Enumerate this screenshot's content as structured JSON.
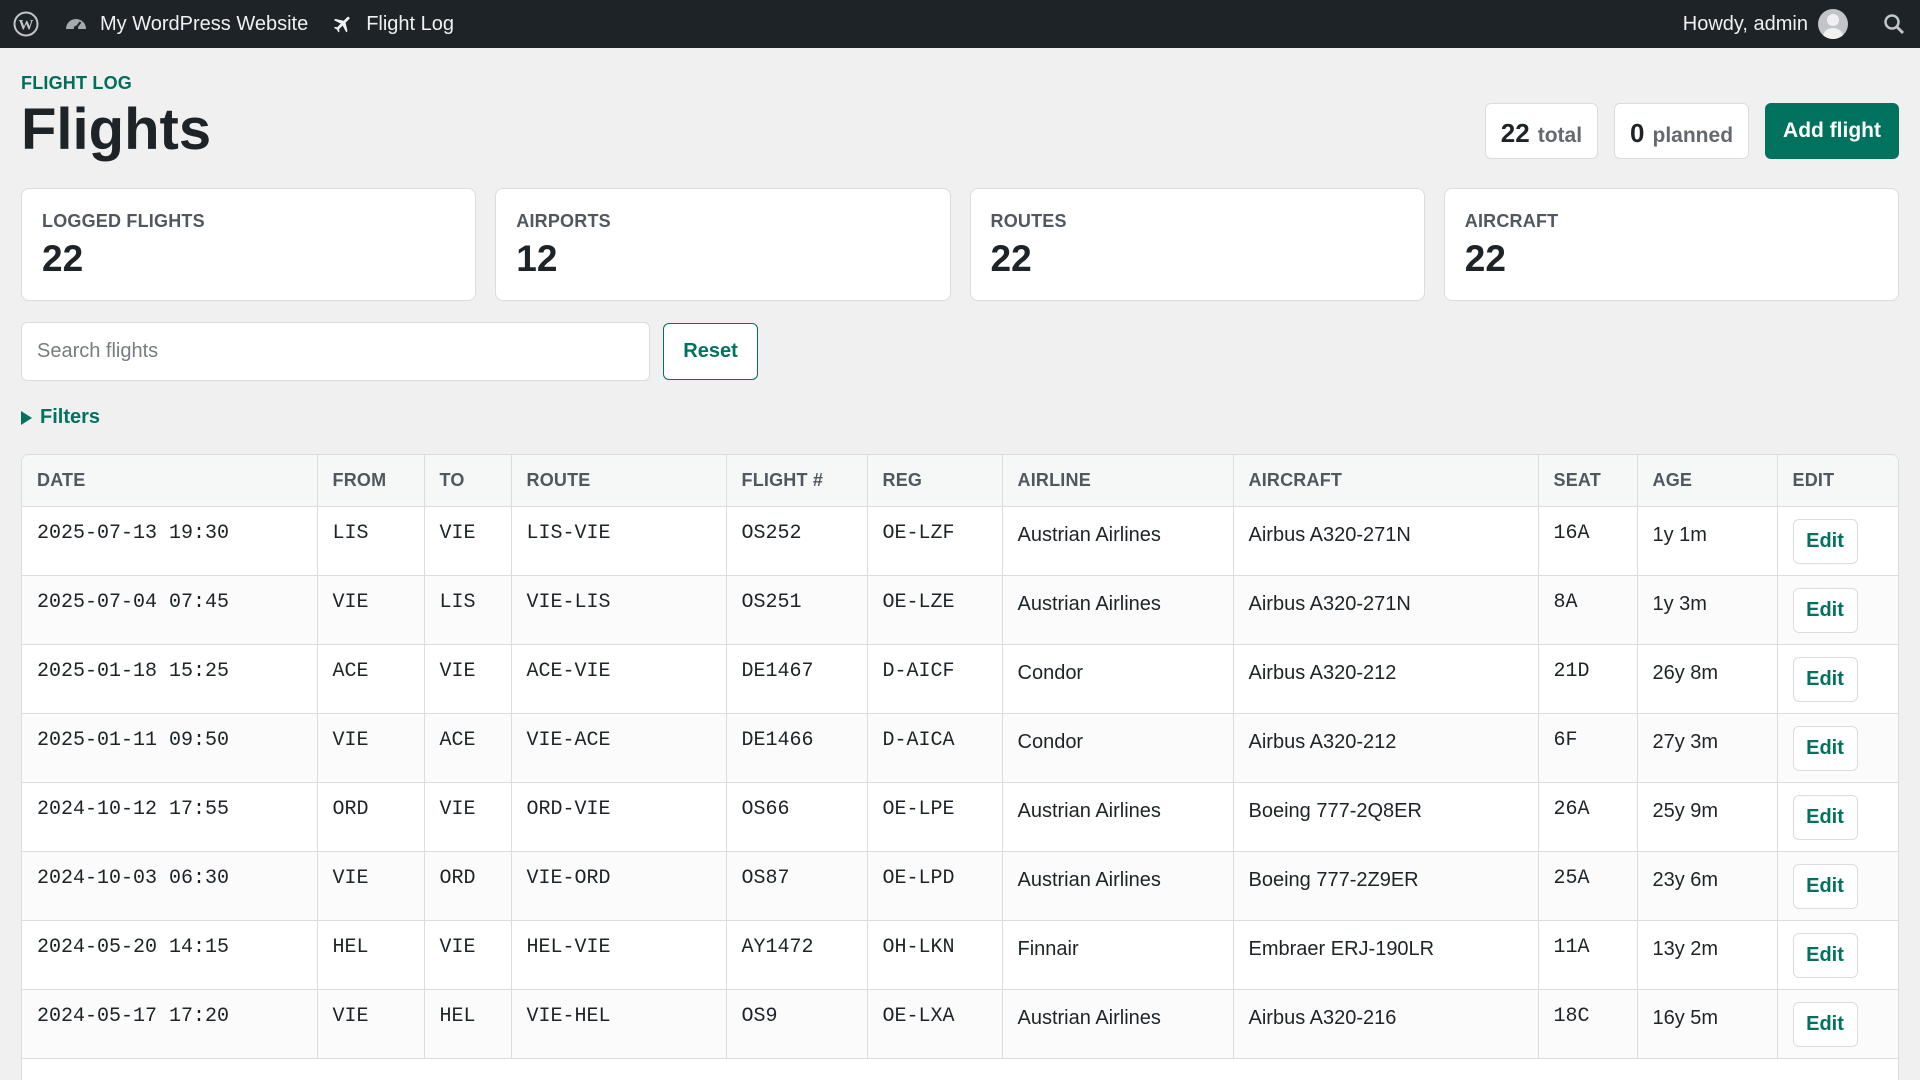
{
  "adminbar": {
    "site_name": "My WordPress Website",
    "plugin_name": "Flight Log",
    "howdy": "Howdy, admin",
    "icons": [
      "wordpress-logo-icon",
      "dashboard-icon",
      "airplane-icon",
      "avatar",
      "search-icon"
    ]
  },
  "header": {
    "eyebrow": "FLIGHT LOG",
    "title": "Flights",
    "total_count": "22",
    "total_label": "total",
    "planned_count": "0",
    "planned_label": "planned",
    "add_label": "Add flight"
  },
  "stats": [
    {
      "label": "LOGGED FLIGHTS",
      "value": "22"
    },
    {
      "label": "AIRPORTS",
      "value": "12"
    },
    {
      "label": "ROUTES",
      "value": "22"
    },
    {
      "label": "AIRCRAFT",
      "value": "22"
    }
  ],
  "search": {
    "placeholder": "Search flights",
    "value": "",
    "reset_label": "Reset"
  },
  "filters_label": "Filters",
  "table": {
    "columns": [
      "DATE",
      "FROM",
      "TO",
      "ROUTE",
      "FLIGHT #",
      "REG",
      "AIRLINE",
      "AIRCRAFT",
      "SEAT",
      "AGE",
      "EDIT"
    ],
    "edit_label": "Edit",
    "rows": [
      {
        "date": "2025-07-13 19:30",
        "from": "LIS",
        "to": "VIE",
        "route": "LIS-VIE",
        "flight": "OS252",
        "reg": "OE-LZF",
        "airline": "Austrian Airlines",
        "aircraft": "Airbus A320-271N",
        "seat": "16A",
        "age": "1y 1m"
      },
      {
        "date": "2025-07-04 07:45",
        "from": "VIE",
        "to": "LIS",
        "route": "VIE-LIS",
        "flight": "OS251",
        "reg": "OE-LZE",
        "airline": "Austrian Airlines",
        "aircraft": "Airbus A320-271N",
        "seat": "8A",
        "age": "1y 3m"
      },
      {
        "date": "2025-01-18 15:25",
        "from": "ACE",
        "to": "VIE",
        "route": "ACE-VIE",
        "flight": "DE1467",
        "reg": "D-AICF",
        "airline": "Condor",
        "aircraft": "Airbus A320-212",
        "seat": "21D",
        "age": "26y 8m"
      },
      {
        "date": "2025-01-11 09:50",
        "from": "VIE",
        "to": "ACE",
        "route": "VIE-ACE",
        "flight": "DE1466",
        "reg": "D-AICA",
        "airline": "Condor",
        "aircraft": "Airbus A320-212",
        "seat": "6F",
        "age": "27y 3m"
      },
      {
        "date": "2024-10-12 17:55",
        "from": "ORD",
        "to": "VIE",
        "route": "ORD-VIE",
        "flight": "OS66",
        "reg": "OE-LPE",
        "airline": "Austrian Airlines",
        "aircraft": "Boeing 777-2Q8ER",
        "seat": "26A",
        "age": "25y 9m"
      },
      {
        "date": "2024-10-03 06:30",
        "from": "VIE",
        "to": "ORD",
        "route": "VIE-ORD",
        "flight": "OS87",
        "reg": "OE-LPD",
        "airline": "Austrian Airlines",
        "aircraft": "Boeing 777-2Z9ER",
        "seat": "25A",
        "age": "23y 6m"
      },
      {
        "date": "2024-05-20 14:15",
        "from": "HEL",
        "to": "VIE",
        "route": "HEL-VIE",
        "flight": "AY1472",
        "reg": "OH-LKN",
        "airline": "Finnair",
        "aircraft": "Embraer ERJ-190LR",
        "seat": "11A",
        "age": "13y 2m"
      },
      {
        "date": "2024-05-17 17:20",
        "from": "VIE",
        "to": "HEL",
        "route": "VIE-HEL",
        "flight": "OS9",
        "reg": "OE-LXA",
        "airline": "Austrian Airlines",
        "aircraft": "Airbus A320-216",
        "seat": "18C",
        "age": "16y 5m"
      }
    ]
  }
}
